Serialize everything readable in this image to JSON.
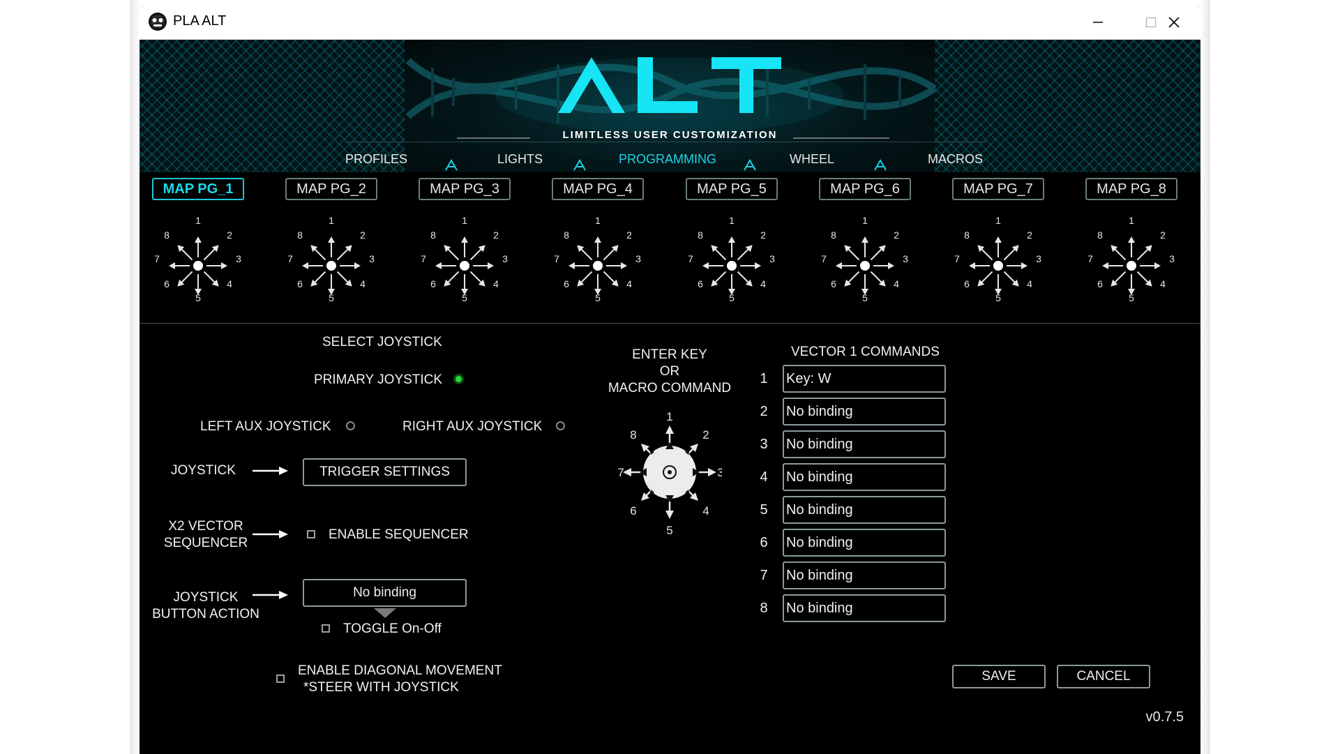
{
  "window": {
    "title": "PLA ALT",
    "controls": [
      "minimize-icon",
      "maximize-icon",
      "close-icon"
    ]
  },
  "banner": {
    "logo_text": "ALT",
    "tagline": "LIMITLESS USER CUSTOMIZATION"
  },
  "nav": {
    "items": [
      "PROFILES",
      "LIGHTS",
      "PROGRAMMING",
      "WHEEL",
      "MACROS"
    ],
    "active": "PROGRAMMING"
  },
  "map_pages": {
    "items": [
      "MAP PG_1",
      "MAP PG_2",
      "MAP PG_3",
      "MAP PG_4",
      "MAP PG_5",
      "MAP PG_6",
      "MAP PG_7",
      "MAP PG_8"
    ],
    "active": "MAP PG_1",
    "direction_labels": [
      "1",
      "2",
      "3",
      "4",
      "5",
      "6",
      "7",
      "8"
    ]
  },
  "joystick": {
    "title": "SELECT JOYSTICK",
    "primary": "PRIMARY JOYSTICK",
    "left_aux": "LEFT AUX JOYSTICK",
    "right_aux": "RIGHT AUX JOYSTICK",
    "selected": "PRIMARY JOYSTICK"
  },
  "settings": {
    "joystick_label": "JOYSTICK",
    "trigger_settings": "TRIGGER SETTINGS",
    "sequencer_label_1": "X2 VECTOR",
    "sequencer_label_2": "SEQUENCER",
    "enable_sequencer": "ENABLE SEQUENCER",
    "button_action_label_1": "JOYSTICK",
    "button_action_label_2": "BUTTON ACTION",
    "button_action_value": "No binding",
    "toggle": "TOGGLE On-Off",
    "diagonal_1": "ENABLE DIAGONAL MOVEMENT",
    "diagonal_2": "*STEER WITH JOYSTICK"
  },
  "enter_key": {
    "line1": "ENTER KEY",
    "line2": "OR",
    "line3": "MACRO COMMAND"
  },
  "vector": {
    "title": "VECTOR 1 COMMANDS",
    "commands": [
      {
        "n": "1",
        "value": "Key: W"
      },
      {
        "n": "2",
        "value": "No binding"
      },
      {
        "n": "3",
        "value": "No binding"
      },
      {
        "n": "4",
        "value": "No binding"
      },
      {
        "n": "5",
        "value": "No binding"
      },
      {
        "n": "6",
        "value": "No binding"
      },
      {
        "n": "7",
        "value": "No binding"
      },
      {
        "n": "8",
        "value": "No binding"
      }
    ]
  },
  "actions": {
    "save": "SAVE",
    "cancel": "CANCEL"
  },
  "version": "v0.7.5",
  "colors": {
    "accent": "#1fd7ea",
    "radio_on": "#27d83a",
    "background": "#000000"
  }
}
